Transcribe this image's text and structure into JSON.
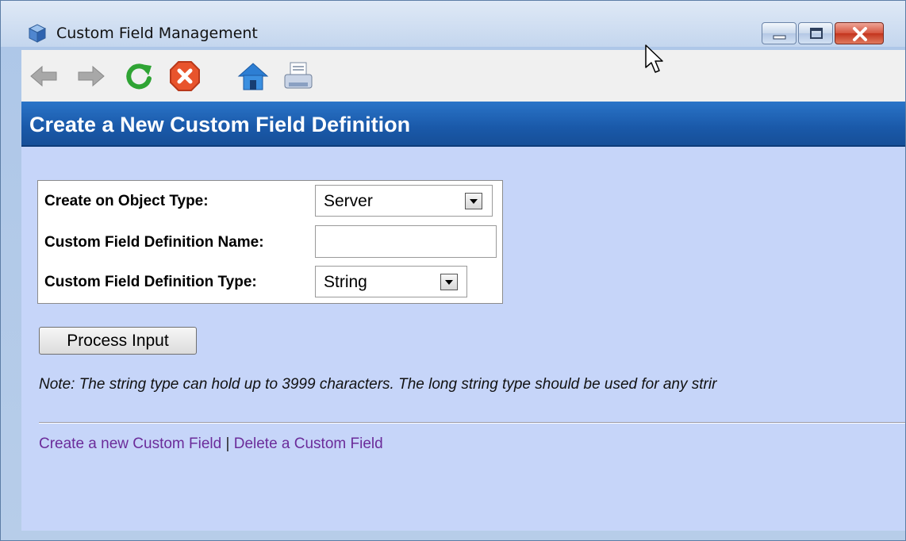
{
  "window": {
    "title": "Custom Field Management"
  },
  "toolbar": {
    "buttons": [
      "back-icon",
      "forward-icon",
      "refresh-icon",
      "stop-icon",
      "home-icon",
      "print-icon"
    ]
  },
  "header": {
    "title": "Create a New Custom Field Definition"
  },
  "form": {
    "object_type_label": "Create on Object Type:",
    "object_type_value": "Server",
    "name_label": "Custom Field Definition Name:",
    "name_value": "",
    "type_label": "Custom Field Definition Type:",
    "type_value": "String"
  },
  "process_button": "Process Input",
  "note": "Note: The string type can hold up to 3999 characters. The long string type should be used for any strir",
  "links": {
    "create": "Create a new Custom Field",
    "separator": "|",
    "delete": "Delete a Custom Field"
  },
  "colors": {
    "header_bar": "#1a59a9",
    "content_bg": "#c6d5f9",
    "link": "#6b2c9a"
  }
}
